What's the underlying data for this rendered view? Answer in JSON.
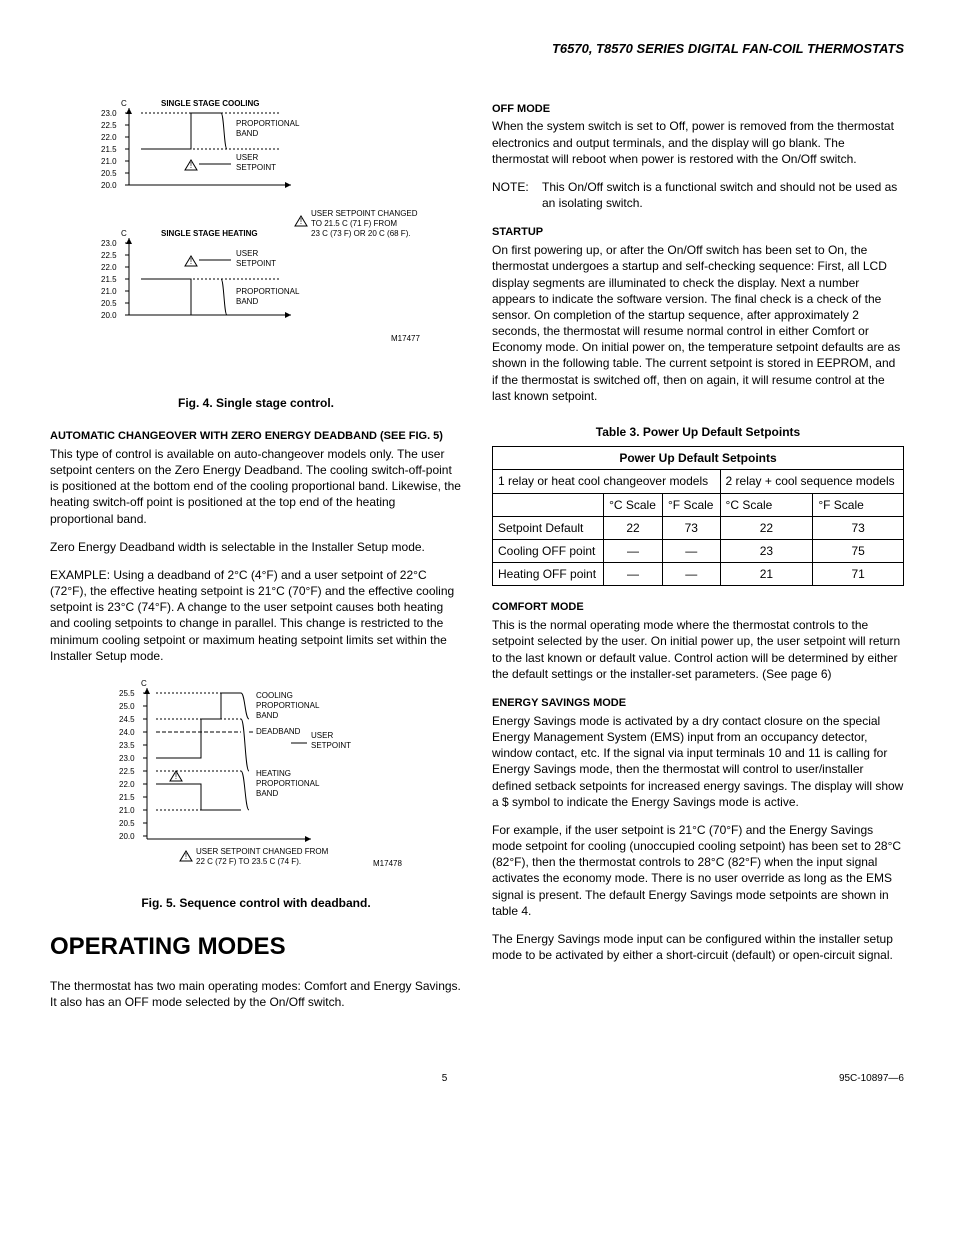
{
  "header": "T6570, T8570 SERIES DIGITAL FAN-COIL THERMOSTATS",
  "left": {
    "fig4": {
      "caption": "Fig. 4. Single stage control.",
      "cool_title": "SINGLE STAGE COOLING",
      "heat_title": "SINGLE STAGE HEATING",
      "c_label": "C",
      "ticks": [
        "23.0",
        "22.5",
        "22.0",
        "21.5",
        "21.0",
        "20.5",
        "20.0"
      ],
      "prop_band": "PROPORTIONAL\nBAND",
      "user_sp": "USER\nSETPOINT",
      "change_note": "USER SETPOINT CHANGED\nTO 21.5  C (71  F) FROM\n23  C (73  F) OR 20  C (68  F).",
      "code": "M17477"
    },
    "auto_head": "AUTOMATIC CHANGEOVER WITH ZERO ENERGY DEADBAND (SEE FIG. 5)",
    "auto_p1": "This type of control is available on auto-changeover models only. The user setpoint centers on the Zero Energy Deadband. The cooling switch-off-point is positioned at the bottom end of the cooling proportional band. Likewise, the heating switch-off point is positioned at the top end of the heating proportional band.",
    "auto_p2": "Zero Energy Deadband width is selectable in the Installer Setup mode.",
    "auto_p3": "EXAMPLE: Using a deadband of 2°C (4°F) and a user setpoint of 22°C (72°F), the effective heating setpoint is 21°C (70°F) and the effective cooling setpoint is 23°C (74°F). A change to the user setpoint causes both heating and cooling setpoints to change in parallel. This change is restricted to the minimum cooling setpoint or maximum heating setpoint limits set within the Installer Setup mode.",
    "fig5": {
      "caption": "Fig. 5. Sequence control with deadband.",
      "c_label": "C",
      "ticks": [
        "25.5",
        "25.0",
        "24.5",
        "24.0",
        "23.5",
        "23.0",
        "22.5",
        "22.0",
        "21.5",
        "21.0",
        "20.5",
        "20.0"
      ],
      "cool_band": "COOLING\nPROPORTIONAL\nBAND",
      "deadband": "DEADBAND",
      "user_sp": "USER\nSETPOINT",
      "heat_band": "HEATING\nPROPORTIONAL\nBAND",
      "change_note": "USER SETPOINT CHANGED FROM\n22 C (72 F) TO 23.5 C (74 F).",
      "code": "M17478"
    },
    "op_modes_title": "OPERATING MODES",
    "op_modes_p": "The thermostat has two main operating modes: Comfort and Energy Savings. It also has an OFF mode selected by the On/Off switch."
  },
  "right": {
    "off_head": "OFF MODE",
    "off_p": "When the system switch is set to Off, power is removed from the thermostat electronics and output terminals, and the display will go blank. The thermostat will reboot when power is restored with the On/Off switch.",
    "note_label": "NOTE:",
    "note_text": "This On/Off switch is a functional switch and should not be used as an isolating switch.",
    "startup_head": "STARTUP",
    "startup_p": "On first powering up, or after the On/Off switch has been set to On, the thermostat undergoes a startup and self-checking sequence: First, all LCD display segments are illuminated to check the display. Next a number appears to indicate the software version. The final check is a check of the sensor. On completion of the startup sequence, after approximately 2 seconds, the thermostat will resume normal control in either Comfort or Economy mode. On initial power on, the temperature setpoint defaults are as shown in the following table. The current setpoint is stored in EEPROM, and if the thermostat is switched off, then on again, it will resume control at the last known setpoint.",
    "table_title": "Table 3. Power Up Default Setpoints",
    "table": {
      "super_header": "Power Up Default Setpoints",
      "col1": "1 relay or heat cool changeover models",
      "col2": "2 relay + cool sequence models",
      "scale_c": "°C Scale",
      "scale_f": "°F Scale",
      "rows": [
        {
          "label": "Setpoint Default",
          "a": "22",
          "b": "73",
          "c": "22",
          "d": "73"
        },
        {
          "label": "Cooling OFF point",
          "a": "—",
          "b": "—",
          "c": "23",
          "d": "75"
        },
        {
          "label": "Heating OFF point",
          "a": "—",
          "b": "—",
          "c": "21",
          "d": "71"
        }
      ]
    },
    "comfort_head": "COMFORT MODE",
    "comfort_p": "This is the normal operating mode where the thermostat controls to the setpoint selected by the user. On initial power up, the user setpoint will return to the last known or default value. Control action will be determined by either the default settings or the installer-set parameters. (See page 6)",
    "energy_head": "ENERGY SAVINGS MODE",
    "energy_p1": "Energy Savings mode is activated by a dry contact closure on the special Energy Management System (EMS) input from an occupancy detector, window contact, etc. If the signal via input terminals 10 and 11 is calling for Energy Savings mode, then the thermostat will control to user/installer defined setback setpoints for increased energy savings. The display will show a $ symbol to indicate the Energy Savings mode is active.",
    "energy_p2": "For example, if the user setpoint is 21°C (70°F) and the Energy Savings mode setpoint for cooling (unoccupied cooling setpoint) has been set to 28°C (82°F), then the thermostat controls to 28°C (82°F) when the input signal activates the economy mode. There is no user override as long as the EMS signal is present. The default Energy Savings mode setpoints are shown in table 4.",
    "energy_p3": "The Energy Savings mode input can be configured within the installer setup mode to be activated by either a short-circuit (default) or open-circuit signal."
  },
  "footer": {
    "page": "5",
    "doc": "95C-10897—6"
  },
  "chart_data": [
    {
      "type": "line",
      "title": "Single stage cooling / heating proportional band around user setpoint",
      "ylabel": "°C",
      "ylim": [
        20.0,
        23.0
      ],
      "series": [
        {
          "name": "Cooling prop. band",
          "range": [
            21.5,
            23.0
          ]
        },
        {
          "name": "Heating prop. band",
          "range": [
            20.0,
            21.5
          ]
        }
      ],
      "user_setpoint_after": 21.5,
      "user_setpoint_before_options": [
        23.0,
        20.0
      ]
    },
    {
      "type": "line",
      "title": "Sequence control with deadband",
      "ylabel": "°C",
      "ylim": [
        20.0,
        25.5
      ],
      "series": [
        {
          "name": "Cooling prop. band",
          "range": [
            24.5,
            25.5
          ]
        },
        {
          "name": "Deadband",
          "range": [
            22.5,
            24.5
          ]
        },
        {
          "name": "Heating prop. band",
          "range": [
            21.0,
            22.5
          ]
        }
      ],
      "user_setpoint_before": 22.0,
      "user_setpoint_after": 23.5
    }
  ]
}
